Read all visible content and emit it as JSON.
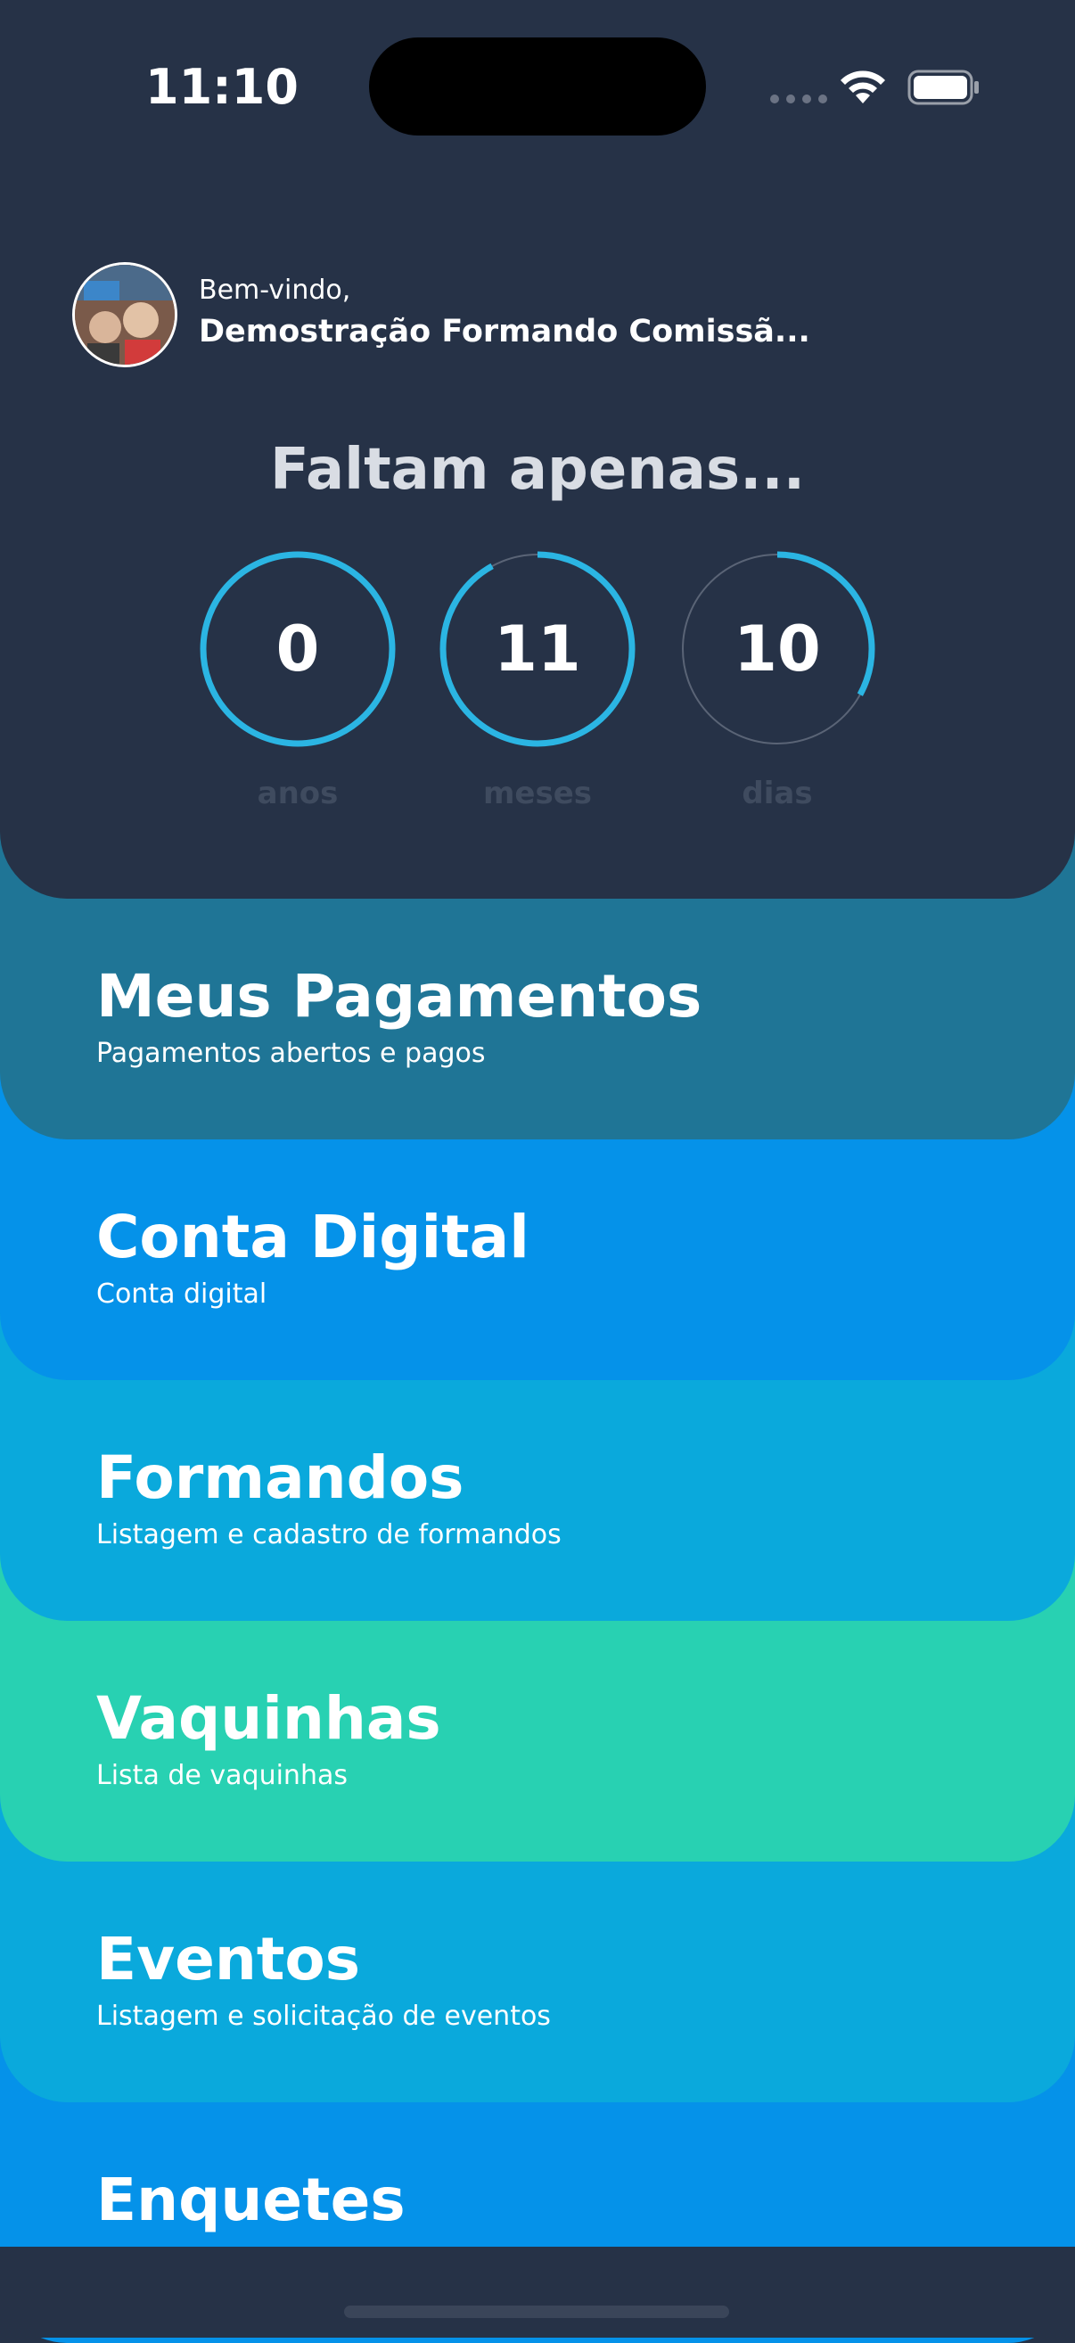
{
  "status_bar": {
    "time": "11:10"
  },
  "header": {
    "welcome": "Bem-vindo,",
    "user_name": "Demostração Formando Comissã...",
    "countdown_title": "Faltam apenas...",
    "countdown": [
      {
        "value": "0",
        "label": "anos",
        "progress": 1.0
      },
      {
        "value": "11",
        "label": "meses",
        "progress": 0.92
      },
      {
        "value": "10",
        "label": "dias",
        "progress": 0.33
      }
    ]
  },
  "menu": [
    {
      "title": "Meus Pagamentos",
      "subtitle": "Pagamentos abertos e pagos",
      "color": "#1f7596"
    },
    {
      "title": "Conta Digital",
      "subtitle": "Conta digital",
      "color": "#0592e9"
    },
    {
      "title": "Formandos",
      "subtitle": "Listagem e cadastro de formandos",
      "color": "#0aa9dc"
    },
    {
      "title": "Vaquinhas",
      "subtitle": "Lista de vaquinhas",
      "color": "#28d1b2"
    },
    {
      "title": "Eventos",
      "subtitle": "Listagem e solicitação de eventos",
      "color": "#0aa9dc"
    },
    {
      "title": "Enquetes",
      "subtitle": "",
      "color": "#0592e9"
    }
  ],
  "colors": {
    "background": "#263247",
    "ring_accent": "#2bb5e3",
    "ring_track": "#5a6476"
  }
}
